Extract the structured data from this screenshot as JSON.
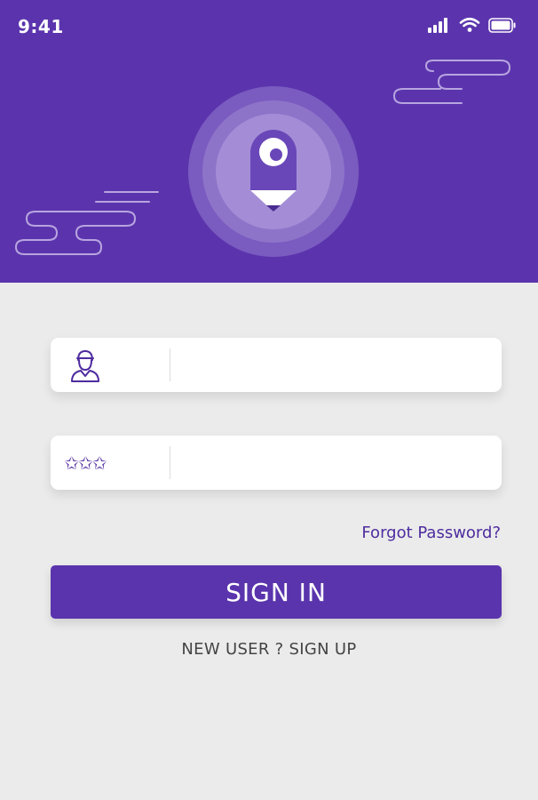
{
  "status_bar": {
    "time": "9:41",
    "icons": [
      "signal-icon",
      "wifi-icon",
      "battery-icon"
    ]
  },
  "header": {
    "background_color": "#5b34ad",
    "logo_icon": "pencil-pin-logo"
  },
  "login_form": {
    "username_field": {
      "icon": "user-icon",
      "value": "",
      "placeholder": ""
    },
    "password_field": {
      "icon": "password-stars-icon",
      "icon_text": "✩✩✩",
      "value": "",
      "placeholder": ""
    },
    "forgot_password_label": "Forgot Password?",
    "sign_in_label": "SIGN IN",
    "sign_up_label": "NEW USER ? SIGN UP"
  },
  "colors": {
    "accent": "#5a34ad",
    "page_background": "#ebebeb",
    "field_background": "#ffffff"
  }
}
